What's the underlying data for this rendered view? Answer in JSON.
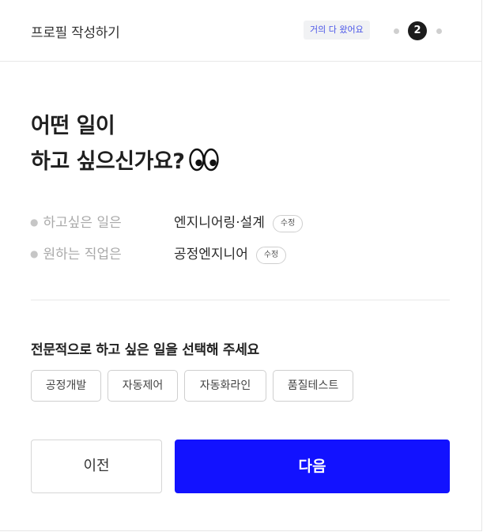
{
  "header": {
    "title": "프로필 작성하기",
    "progress_badge": "거의 다 왔어요",
    "current_step": "2"
  },
  "headline": {
    "line1": "어떤 일이",
    "line2": "하고 싶으신가요?",
    "emoji_icon": "eyes-icon"
  },
  "summary": {
    "rows": [
      {
        "label": "하고싶은 일은",
        "value": "엔지니어링·설계",
        "edit_label": "수정"
      },
      {
        "label": "원하는 직업은",
        "value": "공정엔지니어",
        "edit_label": "수정"
      }
    ]
  },
  "selection": {
    "title": "전문적으로 하고 싶은 일을 선택해 주세요",
    "options": [
      "공정개발",
      "자동제어",
      "자동화라인",
      "품질테스트"
    ]
  },
  "footer": {
    "prev_label": "이전",
    "next_label": "다음"
  },
  "colors": {
    "primary": "#1212ff",
    "badge_text": "#4a55e8",
    "step_active": "#1c1c1c",
    "step_inactive": "#cfcfcf"
  }
}
